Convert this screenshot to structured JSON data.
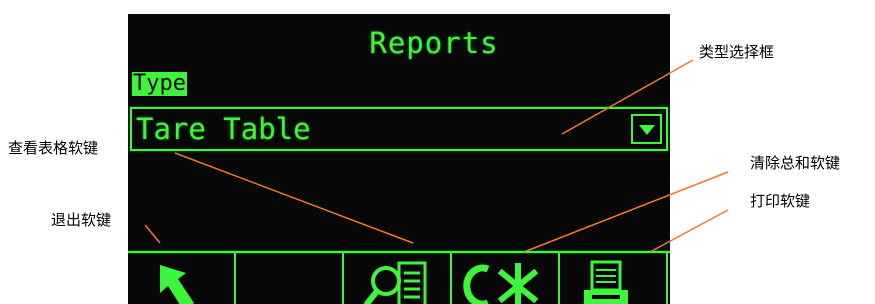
{
  "screen": {
    "title": "Reports",
    "type_label": "Type",
    "select_value": "Tare Table"
  },
  "softkeys": [
    {
      "name": "exit",
      "icon": "exit-arrow-icon"
    },
    {
      "name": "blank",
      "icon": ""
    },
    {
      "name": "view-table",
      "icon": "view-table-icon"
    },
    {
      "name": "clear-total",
      "icon": "clear-total-icon",
      "glyph": "C✱"
    },
    {
      "name": "print",
      "icon": "printer-icon"
    }
  ],
  "callouts": {
    "type_select": "类型选择框",
    "view_table": "查看表格软键",
    "clear_total": "清除总和软键",
    "print": "打印软键",
    "exit": "退出软键"
  },
  "colors": {
    "phosphor": "#3df53a",
    "screen_bg": "#080808",
    "leader": "#f07830"
  }
}
